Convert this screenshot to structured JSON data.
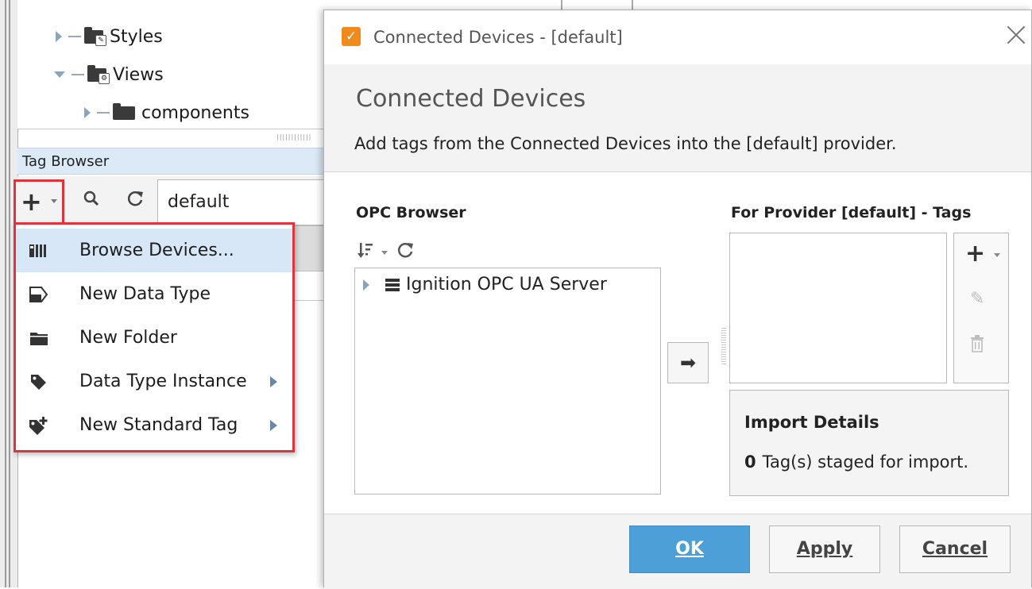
{
  "tree": {
    "items": [
      {
        "label": "Styles",
        "expanded": false
      },
      {
        "label": "Views",
        "expanded": true
      },
      {
        "label": "components",
        "expanded": false
      }
    ]
  },
  "tag_browser": {
    "header": "Tag Browser",
    "provider_value": "default"
  },
  "menu": {
    "items": [
      {
        "label": "Browse Devices...",
        "icon": "browse-devices-icon",
        "submenu": false,
        "active": true
      },
      {
        "label": "New Data Type",
        "icon": "data-type-icon",
        "submenu": false,
        "active": false
      },
      {
        "label": "New Folder",
        "icon": "folder-icon",
        "submenu": false,
        "active": false
      },
      {
        "label": "Data Type Instance",
        "icon": "tag-instance-icon",
        "submenu": true,
        "active": false
      },
      {
        "label": "New Standard Tag",
        "icon": "tag-add-icon",
        "submenu": true,
        "active": false
      }
    ]
  },
  "dialog": {
    "window_title": "Connected Devices - [default]",
    "heading": "Connected Devices",
    "subheading": "Add tags from the Connected Devices into the [default] provider.",
    "opc_label": "OPC Browser",
    "opc_server": "Ignition OPC UA Server",
    "tags_label": "For Provider [default] - Tags",
    "import_title": "Import Details",
    "staged_count": "0",
    "staged_text": "Tag(s) staged for import.",
    "ok_label": "OK",
    "apply_label": "Apply",
    "cancel_label": "Cancel"
  },
  "colors": {
    "highlight_border": "#e0343c",
    "menu_active": "#d7e7f7",
    "ok_button": "#4da0d7",
    "tag_header": "#dce9f6"
  }
}
